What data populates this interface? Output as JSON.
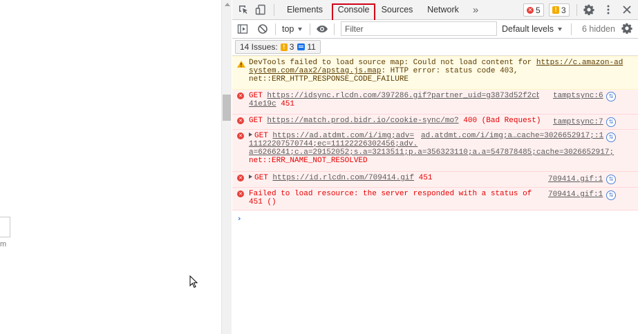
{
  "page": {
    "text_fragment": "m"
  },
  "devtools": {
    "tabs": {
      "elements": "Elements",
      "console": "Console",
      "sources": "Sources",
      "network": "Network",
      "more": "»"
    },
    "badges": {
      "errors": "5",
      "warnings": "3"
    },
    "console_toolbar": {
      "context": "top",
      "filter_placeholder": "Filter",
      "levels": "Default levels",
      "hidden": "6 hidden"
    },
    "issues": {
      "label": "14 Issues:",
      "warnings": "3",
      "infos": "11"
    },
    "messages": [
      {
        "level": "warning",
        "text1": "DevTools failed to load source map: Could not load content for ",
        "link1": "https://c.amazon-ad",
        "link2": "system.com/aax2/apstag.js.map",
        "text2": ": HTTP error: status code 403,",
        "text3": "net::ERR_HTTP_RESPONSE_CODE_FAILURE"
      },
      {
        "level": "error",
        "method": "GET ",
        "url1": "https://idsync.rlcdn.com/397286.gif?partner_uid=g3873d52f2cbef",
        "url2": "41e19c",
        "status": " 451",
        "source": "tamptsync:6"
      },
      {
        "level": "error",
        "method": "GET ",
        "url1": "https://match.prod.bidr.io/cookie-sync/mo?",
        "status": " 400 (Bad Request)",
        "source": "tamptsync:7"
      },
      {
        "level": "error",
        "method": "GET ",
        "url1": "https://ad.atdmt.com/i/img;adv=",
        "url2": "11122207570744;ec=11122226302456;adv.",
        "url3": "a=6266241;c.a=29152052;s.a=3213511;p.a=356323110;a.a=547878485;cache=3026652917;",
        "text4": "net::ERR_NAME_NOT_RESOLVED",
        "source": "ad.atdmt.com/i/img;a…cache=3026652917;:1"
      },
      {
        "level": "error",
        "method": "GET ",
        "url1": "https://id.rlcdn.com/709414.gif",
        "status": " 451",
        "source": "709414.gif:1"
      },
      {
        "level": "error",
        "text1": "Failed to load resource: the server responded with a status of",
        "text2": "451 ()",
        "source": "709414.gif:1"
      }
    ],
    "prompt": "›"
  },
  "colors": {
    "console_tab_highlight": "#d0021b",
    "error_bg": "#fff0f0",
    "error_text": "#e50000",
    "warning_bg": "#fffbe5",
    "accent": "#1a73e8"
  }
}
